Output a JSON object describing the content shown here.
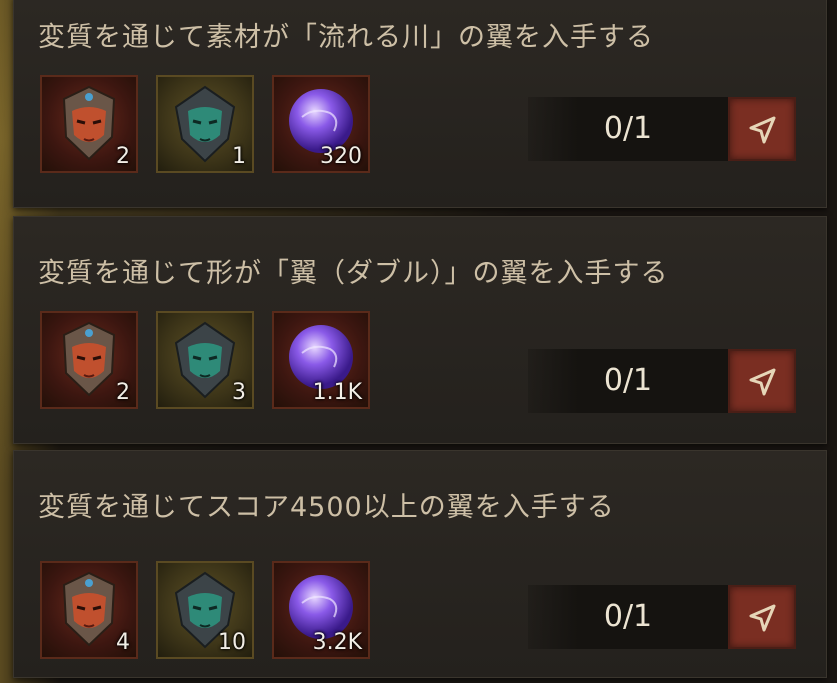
{
  "quests": [
    {
      "title": "変質を通じて素材が「流れる川」の翼を入手する",
      "items": [
        {
          "icon": "crimson-mask-icon",
          "count": "2"
        },
        {
          "icon": "jade-mask-icon",
          "count": "1"
        },
        {
          "icon": "purple-orb-icon",
          "count": "320"
        }
      ],
      "progress": "0/1"
    },
    {
      "title": "変質を通じて形が「翼（ダブル）」の翼を入手する",
      "items": [
        {
          "icon": "crimson-mask-icon",
          "count": "2"
        },
        {
          "icon": "jade-mask-icon",
          "count": "3"
        },
        {
          "icon": "purple-orb-icon",
          "count": "1.1K"
        }
      ],
      "progress": "0/1"
    },
    {
      "title": "変質を通じてスコア4500以上の翼を入手する",
      "items": [
        {
          "icon": "crimson-mask-icon",
          "count": "4"
        },
        {
          "icon": "jade-mask-icon",
          "count": "10"
        },
        {
          "icon": "purple-orb-icon",
          "count": "3.2K"
        }
      ],
      "progress": "0/1"
    }
  ],
  "colors": {
    "card_bg": "#2c2823",
    "title_text": "#cdbfa6",
    "button_bg": "#7a2e22",
    "button_icon": "#e6d6b8"
  }
}
